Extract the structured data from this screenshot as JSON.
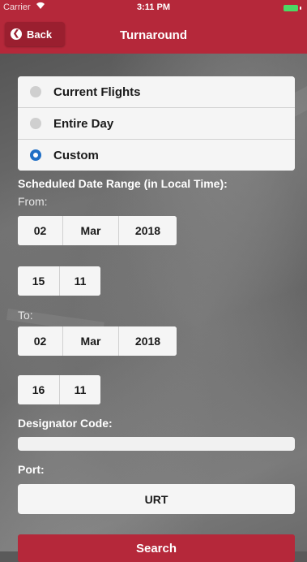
{
  "status_bar": {
    "carrier": "Carrier",
    "wifi_icon": "wifi-icon",
    "time": "3:11 PM",
    "battery_icon": "battery-icon"
  },
  "nav": {
    "back_label": "Back",
    "back_icon": "chevron-left-icon",
    "title": "Turnaround"
  },
  "filter_options": {
    "items": [
      {
        "label": "Current Flights",
        "selected": false
      },
      {
        "label": "Entire Day",
        "selected": false
      },
      {
        "label": "Custom",
        "selected": true
      }
    ]
  },
  "date_range": {
    "heading": "Scheduled Date Range (in Local Time):",
    "from_label": "From:",
    "to_label": "To:",
    "from": {
      "day": "02",
      "month": "Mar",
      "year": "2018",
      "hour": "15",
      "minute": "11"
    },
    "to": {
      "day": "02",
      "month": "Mar",
      "year": "2018",
      "hour": "16",
      "minute": "11"
    }
  },
  "designator": {
    "label": "Designator Code:",
    "value": ""
  },
  "port": {
    "label": "Port:",
    "value": "URT"
  },
  "search_label": "Search",
  "colors": {
    "brand": "#b5283a",
    "radio_selected": "#1f6fc5",
    "battery": "#4cd964"
  }
}
